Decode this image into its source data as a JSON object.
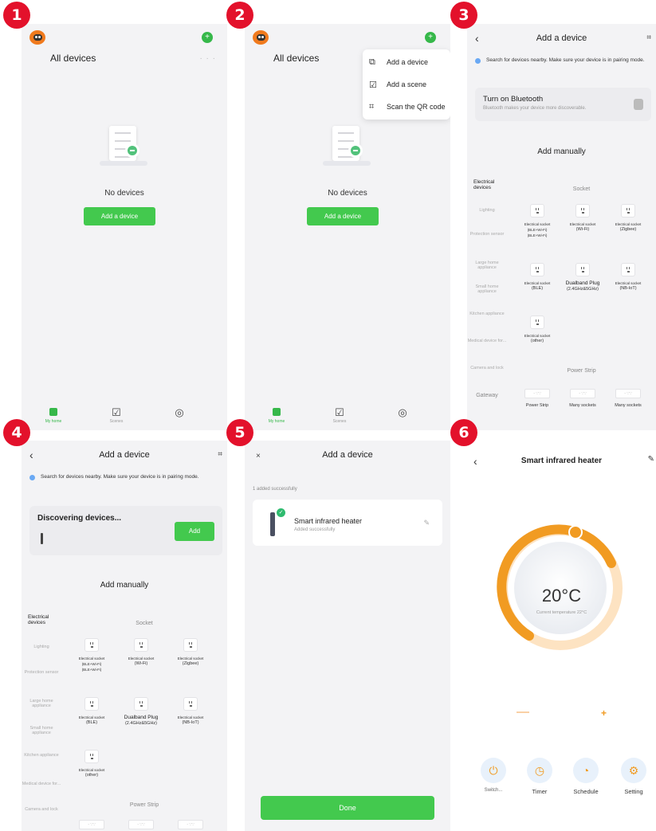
{
  "steps": [
    "1",
    "2",
    "3",
    "4",
    "5",
    "6"
  ],
  "home": {
    "title": "All devices",
    "more": "· · ·",
    "empty_text": "No devices",
    "add_button": "Add a device",
    "tabs": [
      {
        "label": "My home",
        "icon": "home-icon"
      },
      {
        "label": "Scenes",
        "icon": "checkbox-icon"
      },
      {
        "label": "",
        "icon": "profile-icon"
      }
    ]
  },
  "menu": {
    "items": [
      {
        "label": "Add a device",
        "icon": "add-device-icon"
      },
      {
        "label": "Add a scene",
        "icon": "add-scene-icon"
      },
      {
        "label": "Scan the QR code",
        "icon": "scan-icon"
      }
    ]
  },
  "add_device": {
    "title": "Add a device",
    "hint": "Search for devices nearby. Make sure your device is in pairing mode.",
    "bluetooth_title": "Turn on Bluetooth",
    "bluetooth_sub": "Bluetooth makes your device more discoverable.",
    "add_manually": "Add manually",
    "discovering": "Discovering devices...",
    "discover_add": "Add",
    "categories": [
      "Electrical devices",
      "Lighting",
      "Protection sensor",
      "Large home appliance",
      "Small home appliance",
      "Kitchen appliance",
      "Medical device for...",
      "Camera and lock",
      "Gateway"
    ],
    "socket_title": "Socket",
    "sockets": [
      {
        "l1": "Electrical socket",
        "l2": "(BLE+Wi-Fi)",
        "l3": "(BLE+Wi-Fi)"
      },
      {
        "l1": "Electrical socket",
        "l2": "(Wi-Fi)",
        "l3": ""
      },
      {
        "l1": "Electrical socket",
        "l2": "(Zigbee)",
        "l3": ""
      },
      {
        "l1": "Electrical socket",
        "l2": "(BLE)",
        "l3": ""
      },
      {
        "l1": "Dualband Plug",
        "l2": "(2.4GHz&5GHz)",
        "l3": ""
      },
      {
        "l1": "Electrical socket",
        "l2": "(NB-IoT)",
        "l3": ""
      },
      {
        "l1": "Electrical socket",
        "l2": "(other)",
        "l3": ""
      }
    ],
    "strip_title": "Power Strip",
    "strips": [
      "Power Strip",
      "Many sockets",
      "Many sockets"
    ]
  },
  "done_screen": {
    "title": "Add a device",
    "close": "×",
    "count": "1 added successfully",
    "device_name": "Smart infrared heater",
    "device_status": "Added successfully",
    "done": "Done"
  },
  "heater": {
    "title": "Smart infrared heater",
    "temperature": "20°C",
    "current": "Current temperature 22°C",
    "controls": [
      "Switch...",
      "Timer",
      "Schedule",
      "Setting"
    ],
    "accent": "#f19b22"
  }
}
